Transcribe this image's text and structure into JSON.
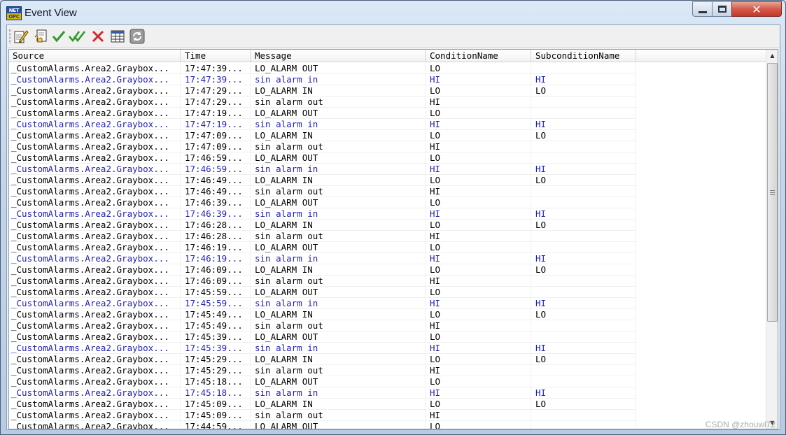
{
  "window": {
    "title": "Event View",
    "icon_text_top": "NET",
    "icon_text_bottom": "OPC",
    "controls": {
      "minimize": "minimize-icon",
      "maximize": "maximize-icon",
      "close": "✕"
    }
  },
  "toolbar": {
    "buttons": [
      {
        "name": "edit-icon"
      },
      {
        "name": "acknowledge-icon"
      },
      {
        "name": "check-icon"
      },
      {
        "name": "double-check-icon"
      },
      {
        "name": "delete-icon"
      },
      {
        "name": "grid-icon"
      },
      {
        "name": "refresh-icon"
      }
    ],
    "colors": {
      "check": "#2e9b2e",
      "delete": "#d22a2a"
    }
  },
  "list": {
    "columns": [
      "Source",
      "Time",
      "Message",
      "ConditionName",
      "SubconditionName"
    ],
    "highlight_color": "#1f1fb8",
    "rows": [
      {
        "source": "_CustomAlarms.Area2.Graybox...",
        "time": "17:47:39...",
        "message": "LO_ALARM OUT",
        "condition": "LO",
        "subcondition": "",
        "highlight": false
      },
      {
        "source": "_CustomAlarms.Area2.Graybox...",
        "time": "17:47:39...",
        "message": "sin alarm in",
        "condition": "HI",
        "subcondition": "HI",
        "highlight": true
      },
      {
        "source": "_CustomAlarms.Area2.Graybox...",
        "time": "17:47:29...",
        "message": "LO_ALARM IN",
        "condition": "LO",
        "subcondition": "LO",
        "highlight": false
      },
      {
        "source": "_CustomAlarms.Area2.Graybox...",
        "time": "17:47:29...",
        "message": "sin alarm out",
        "condition": "HI",
        "subcondition": "",
        "highlight": false
      },
      {
        "source": "_CustomAlarms.Area2.Graybox...",
        "time": "17:47:19...",
        "message": "LO_ALARM OUT",
        "condition": "LO",
        "subcondition": "",
        "highlight": false
      },
      {
        "source": "_CustomAlarms.Area2.Graybox...",
        "time": "17:47:19...",
        "message": "sin alarm in",
        "condition": "HI",
        "subcondition": "HI",
        "highlight": true
      },
      {
        "source": "_CustomAlarms.Area2.Graybox...",
        "time": "17:47:09...",
        "message": "LO_ALARM IN",
        "condition": "LO",
        "subcondition": "LO",
        "highlight": false
      },
      {
        "source": "_CustomAlarms.Area2.Graybox...",
        "time": "17:47:09...",
        "message": "sin alarm out",
        "condition": "HI",
        "subcondition": "",
        "highlight": false
      },
      {
        "source": "_CustomAlarms.Area2.Graybox...",
        "time": "17:46:59...",
        "message": "LO_ALARM OUT",
        "condition": "LO",
        "subcondition": "",
        "highlight": false
      },
      {
        "source": "_CustomAlarms.Area2.Graybox...",
        "time": "17:46:59...",
        "message": "sin alarm in",
        "condition": "HI",
        "subcondition": "HI",
        "highlight": true
      },
      {
        "source": "_CustomAlarms.Area2.Graybox...",
        "time": "17:46:49...",
        "message": "LO_ALARM IN",
        "condition": "LO",
        "subcondition": "LO",
        "highlight": false
      },
      {
        "source": "_CustomAlarms.Area2.Graybox...",
        "time": "17:46:49...",
        "message": "sin alarm out",
        "condition": "HI",
        "subcondition": "",
        "highlight": false
      },
      {
        "source": "_CustomAlarms.Area2.Graybox...",
        "time": "17:46:39...",
        "message": "LO_ALARM OUT",
        "condition": "LO",
        "subcondition": "",
        "highlight": false
      },
      {
        "source": "_CustomAlarms.Area2.Graybox...",
        "time": "17:46:39...",
        "message": "sin alarm in",
        "condition": "HI",
        "subcondition": "HI",
        "highlight": true
      },
      {
        "source": "_CustomAlarms.Area2.Graybox...",
        "time": "17:46:28...",
        "message": "LO_ALARM IN",
        "condition": "LO",
        "subcondition": "LO",
        "highlight": false
      },
      {
        "source": "_CustomAlarms.Area2.Graybox...",
        "time": "17:46:28...",
        "message": "sin alarm out",
        "condition": "HI",
        "subcondition": "",
        "highlight": false
      },
      {
        "source": "_CustomAlarms.Area2.Graybox...",
        "time": "17:46:19...",
        "message": "LO_ALARM OUT",
        "condition": "LO",
        "subcondition": "",
        "highlight": false
      },
      {
        "source": "_CustomAlarms.Area2.Graybox...",
        "time": "17:46:19...",
        "message": "sin alarm in",
        "condition": "HI",
        "subcondition": "HI",
        "highlight": true
      },
      {
        "source": "_CustomAlarms.Area2.Graybox...",
        "time": "17:46:09...",
        "message": "LO_ALARM IN",
        "condition": "LO",
        "subcondition": "LO",
        "highlight": false
      },
      {
        "source": "_CustomAlarms.Area2.Graybox...",
        "time": "17:46:09...",
        "message": "sin alarm out",
        "condition": "HI",
        "subcondition": "",
        "highlight": false
      },
      {
        "source": "_CustomAlarms.Area2.Graybox...",
        "time": "17:45:59...",
        "message": "LO_ALARM OUT",
        "condition": "LO",
        "subcondition": "",
        "highlight": false
      },
      {
        "source": "_CustomAlarms.Area2.Graybox...",
        "time": "17:45:59...",
        "message": "sin alarm in",
        "condition": "HI",
        "subcondition": "HI",
        "highlight": true
      },
      {
        "source": "_CustomAlarms.Area2.Graybox...",
        "time": "17:45:49...",
        "message": "LO_ALARM IN",
        "condition": "LO",
        "subcondition": "LO",
        "highlight": false
      },
      {
        "source": "_CustomAlarms.Area2.Graybox...",
        "time": "17:45:49...",
        "message": "sin alarm out",
        "condition": "HI",
        "subcondition": "",
        "highlight": false
      },
      {
        "source": "_CustomAlarms.Area2.Graybox...",
        "time": "17:45:39...",
        "message": "LO_ALARM OUT",
        "condition": "LO",
        "subcondition": "",
        "highlight": false
      },
      {
        "source": "_CustomAlarms.Area2.Graybox...",
        "time": "17:45:39...",
        "message": "sin alarm in",
        "condition": "HI",
        "subcondition": "HI",
        "highlight": true
      },
      {
        "source": "_CustomAlarms.Area2.Graybox...",
        "time": "17:45:29...",
        "message": "LO_ALARM IN",
        "condition": "LO",
        "subcondition": "LO",
        "highlight": false
      },
      {
        "source": "_CustomAlarms.Area2.Graybox...",
        "time": "17:45:29...",
        "message": "sin alarm out",
        "condition": "HI",
        "subcondition": "",
        "highlight": false
      },
      {
        "source": "_CustomAlarms.Area2.Graybox...",
        "time": "17:45:18...",
        "message": "LO_ALARM OUT",
        "condition": "LO",
        "subcondition": "",
        "highlight": false
      },
      {
        "source": "_CustomAlarms.Area2.Graybox...",
        "time": "17:45:18...",
        "message": "sin alarm in",
        "condition": "HI",
        "subcondition": "HI",
        "highlight": true
      },
      {
        "source": "_CustomAlarms.Area2.Graybox...",
        "time": "17:45:09...",
        "message": "LO_ALARM IN",
        "condition": "LO",
        "subcondition": "LO",
        "highlight": false
      },
      {
        "source": "_CustomAlarms.Area2.Graybox...",
        "time": "17:45:09...",
        "message": "sin alarm out",
        "condition": "HI",
        "subcondition": "",
        "highlight": false
      },
      {
        "source": "_CustomAlarms.Area2.Graybox...",
        "time": "17:44:59...",
        "message": "LO_ALARM OUT",
        "condition": "LO",
        "subcondition": "",
        "highlight": false
      }
    ]
  },
  "watermark": "CSDN @zhouwl72"
}
